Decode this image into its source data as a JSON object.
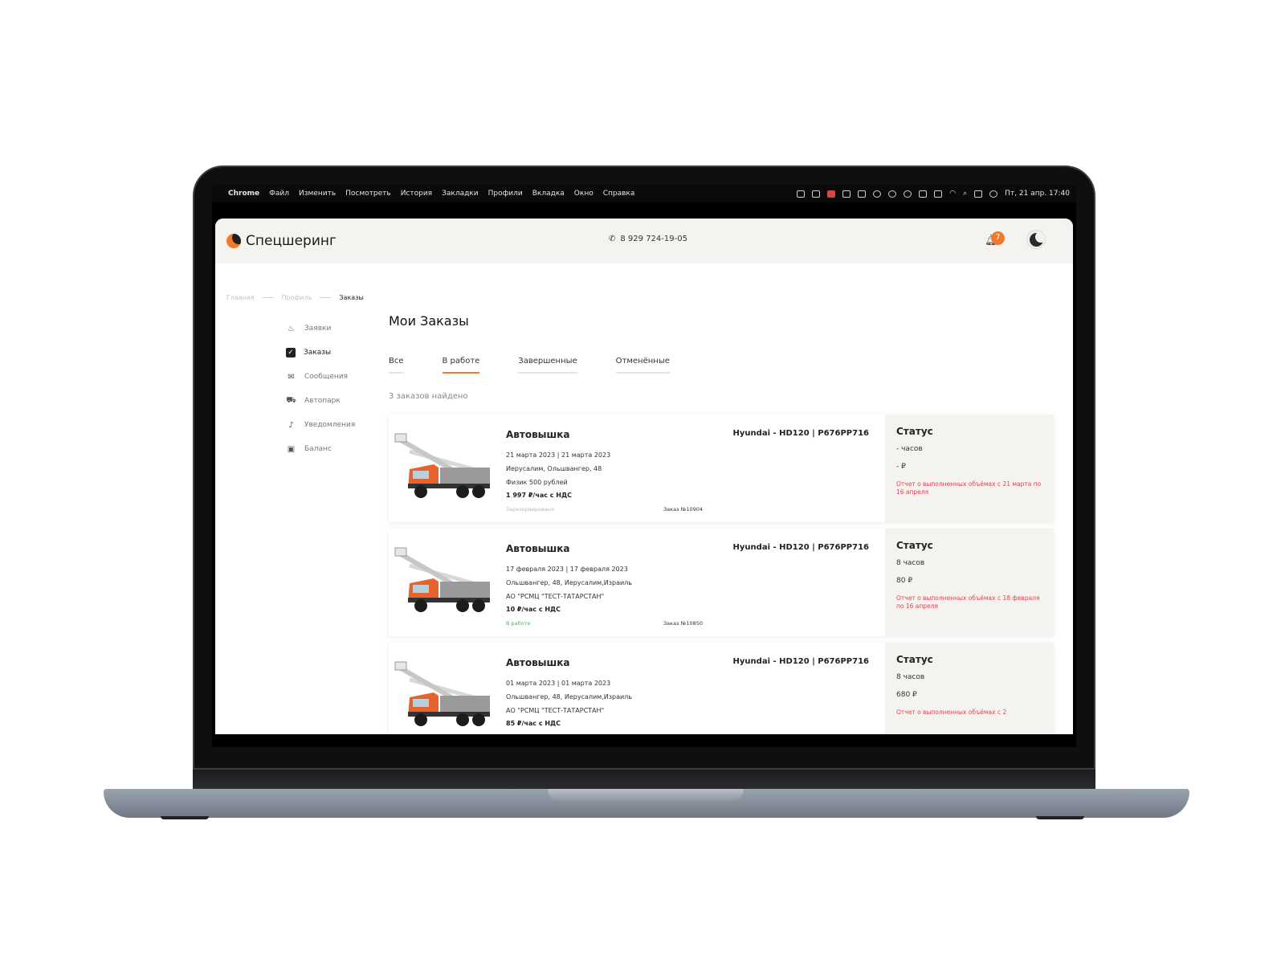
{
  "menubar": {
    "app": "Chrome",
    "menus": [
      "Файл",
      "Изменить",
      "Посмотреть",
      "История",
      "Закладки",
      "Профили",
      "Вкладка",
      "Окно",
      "Справка"
    ],
    "clock": "Пт, 21 апр. 17:40"
  },
  "header": {
    "logo_text": "Спецшеринг",
    "phone": "8 929 724-19-05",
    "notifications_count": "7"
  },
  "breadcrumb": [
    "Главная",
    "Профиль",
    "Заказы"
  ],
  "sidebar": {
    "items": [
      {
        "label": "Заявки",
        "icon": "fire-icon"
      },
      {
        "label": "Заказы",
        "icon": "checkbox-icon"
      },
      {
        "label": "Сообщения",
        "icon": "mail-icon"
      },
      {
        "label": "Автопарк",
        "icon": "truck-icon"
      },
      {
        "label": "Уведомления",
        "icon": "bell-icon"
      },
      {
        "label": "Баланс",
        "icon": "wallet-icon"
      }
    ],
    "active": "Заказы"
  },
  "main": {
    "title": "Мои Заказы",
    "tabs": [
      {
        "label": "Все"
      },
      {
        "label": "В работе"
      },
      {
        "label": "Завершенные"
      },
      {
        "label": "Отменённые"
      }
    ],
    "active_tab": "В работе",
    "found_text": "3 заказов найдено"
  },
  "orders": [
    {
      "name": "Автовышка",
      "vehicle": "Hyundai - HD120 | Р676РР716",
      "dates": "21 марта 2023 | 21 марта 2023",
      "address": "Иерусалим, Ольшвангер, 48",
      "client": "Физик 500 рублей",
      "price": "1 997 ₽/час с НДС",
      "status_label": "Зарезервировано",
      "order_number": "Заказ №10904",
      "side_title": "Статус",
      "hours": "- часов",
      "amount": "- ₽",
      "report": "Отчет о выполненных объёмах с 21 марта по 16 апреля"
    },
    {
      "name": "Автовышка",
      "vehicle": "Hyundai - HD120 | Р676РР716",
      "dates": "17 февраля 2023 | 17 февраля 2023",
      "address": "Ольшвангер, 48, Иерусалим,Израиль",
      "client": "АО \"РСМЦ \"ТЕСТ-ТАТАРСТАН\"",
      "price": "10 ₽/час с НДС",
      "status_label": "В работе",
      "order_number": "Заказ №10850",
      "side_title": "Статус",
      "hours": "8 часов",
      "amount": "80 ₽",
      "report": "Отчет о выполненных объёмах с 18 февраля по 16 апреля"
    },
    {
      "name": "Автовышка",
      "vehicle": "Hyundai - HD120 | Р676РР716",
      "dates": "01 марта 2023 | 01 марта 2023",
      "address": "Ольшвангер, 48, Иерусалим,Израиль",
      "client": "АО \"РСМЦ \"ТЕСТ-ТАТАРСТАН\"",
      "price": "85 ₽/час с НДС",
      "status_label": "",
      "order_number": "",
      "side_title": "Статус",
      "hours": "8 часов",
      "amount": "680 ₽",
      "report": "Отчет о выполненных объёмах с 2"
    }
  ],
  "colors": {
    "accent": "#f07a2c",
    "status_reserved": "#b9b9b9",
    "status_in_work": "#3dbb5a",
    "report_text": "#e0454f",
    "header_bg": "#f5f3ef"
  }
}
